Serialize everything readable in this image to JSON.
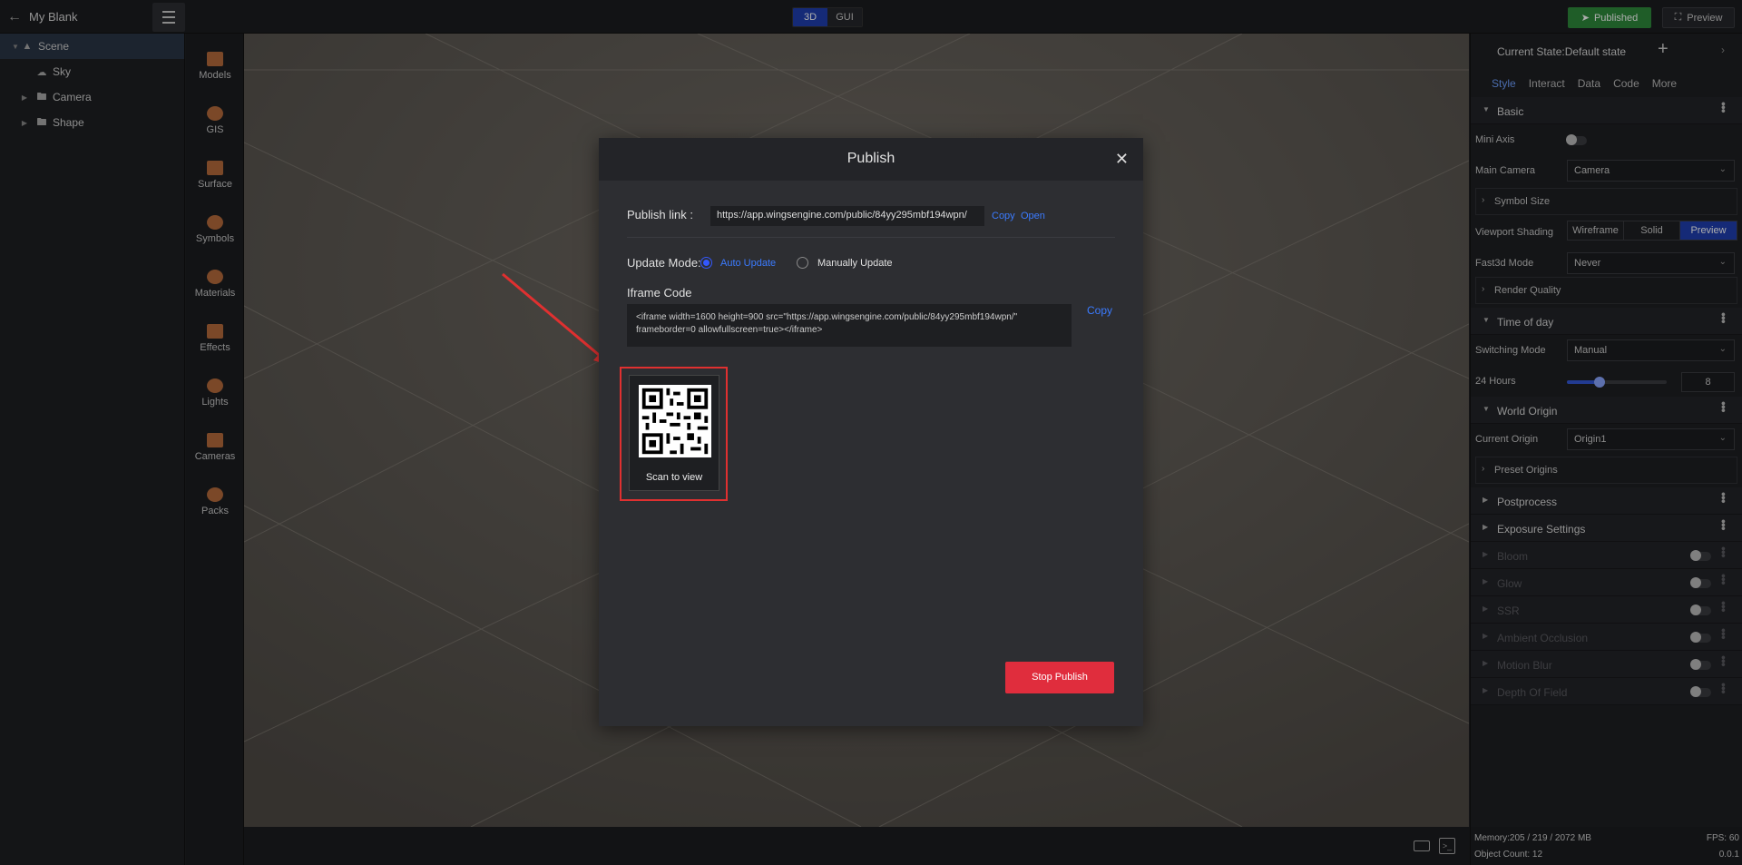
{
  "topbar": {
    "app_title": "My Blank",
    "mode_3d": "3D",
    "mode_gui": "GUI",
    "published_label": "Published",
    "preview_label": "Preview"
  },
  "tree": {
    "items": [
      {
        "label": "Scene",
        "icon": "scene-icon"
      },
      {
        "label": "Sky",
        "icon": "sky-icon"
      },
      {
        "label": "Camera",
        "icon": "folder-icon"
      },
      {
        "label": "Shape",
        "icon": "folder-icon"
      }
    ]
  },
  "toolbox": {
    "items": [
      {
        "label": "Models",
        "icon": "models-icon"
      },
      {
        "label": "GIS",
        "icon": "gis-icon"
      },
      {
        "label": "Surface",
        "icon": "surface-icon"
      },
      {
        "label": "Symbols",
        "icon": "symbols-icon"
      },
      {
        "label": "Materials",
        "icon": "materials-icon"
      },
      {
        "label": "Effects",
        "icon": "effects-icon"
      },
      {
        "label": "Lights",
        "icon": "lights-icon"
      },
      {
        "label": "Cameras",
        "icon": "cameras-icon"
      },
      {
        "label": "Packs",
        "icon": "packs-icon"
      }
    ]
  },
  "right_panel": {
    "state_title": "Current State:Default state",
    "tabs": [
      "Style",
      "Interact",
      "Data",
      "Code",
      "More"
    ],
    "basic": {
      "title": "Basic",
      "mini_axis_label": "Mini Axis",
      "main_camera_label": "Main Camera",
      "main_camera_value": "Camera",
      "symbol_size_label": "Symbol Size",
      "viewport_shading_label": "Viewport Shading",
      "shading_options": [
        "Wireframe",
        "Solid",
        "Preview"
      ],
      "fast3d_label": "Fast3d Mode",
      "fast3d_value": "Never",
      "render_quality_label": "Render Quality"
    },
    "time_of_day": {
      "title": "Time of day",
      "switching_mode_label": "Switching Mode",
      "switching_mode_value": "Manual",
      "hours_label": "24 Hours",
      "hours_value": "8",
      "hours_fraction": 0.33
    },
    "world_origin": {
      "title": "World Origin",
      "current_origin_label": "Current Origin",
      "current_origin_value": "Origin1",
      "preset_origins_label": "Preset Origins"
    },
    "sections": [
      "Postprocess",
      "Exposure Settings"
    ],
    "disabled_sections": [
      "Bloom",
      "Glow",
      "SSR",
      "Ambient Occlusion",
      "Motion Blur",
      "Depth Of Field"
    ],
    "footer": {
      "memory": "Memory:205 / 219 / 2072 MB",
      "fps": "FPS: 60",
      "object_count": "Object Count: 12",
      "version": "0.0.1"
    }
  },
  "modal": {
    "title": "Publish",
    "publish_link_label": "Publish link :",
    "publish_link_value": "https://app.wingsengine.com/public/84yy295mbf194wpn/",
    "copy_label": "Copy",
    "open_label": "Open",
    "update_mode_label": "Update Mode:",
    "auto_update_label": "Auto Update",
    "manual_update_label": "Manually Update",
    "iframe_code_label": "Iframe Code",
    "iframe_code_value": "<iframe width=1600 height=900 src=\"https://app.wingsengine.com/public/84yy295mbf194wpn/\" frameborder=0 allowfullscreen=true></iframe>",
    "iframe_copy_label": "Copy",
    "scan_label": "Scan to view",
    "stop_publish_label": "Stop Publish"
  },
  "colors": {
    "accent_blue": "#3358ff",
    "published_green": "#2f8a3b",
    "stop_red": "#e02d3d",
    "annotation_red": "#e03030"
  }
}
